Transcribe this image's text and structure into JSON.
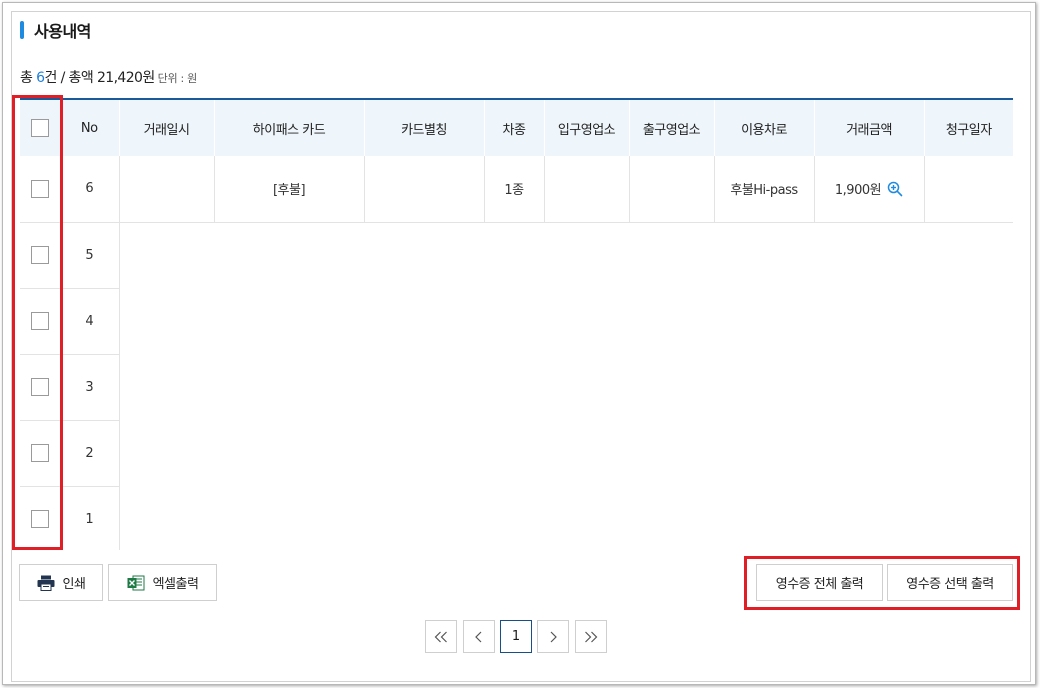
{
  "section": {
    "title": "사용내역"
  },
  "summary": {
    "prefix": "총 ",
    "count": "6",
    "count_suffix": "건 / 총액 21,420원",
    "unit": "단위 : 원"
  },
  "table": {
    "headers": [
      "No",
      "거래일시",
      "하이패스 카드",
      "카드별칭",
      "차종",
      "입구영업소",
      "출구영업소",
      "이용차로",
      "거래금액",
      "청구일자"
    ],
    "rows": [
      {
        "no": "6",
        "datetime": "",
        "card": "[후불]",
        "alias": "",
        "vehicle": "1종",
        "entry": "",
        "exit": "",
        "lane": "후불Hi-pass",
        "amount": "1,900원",
        "billing": ""
      },
      {
        "no": "5"
      },
      {
        "no": "4"
      },
      {
        "no": "3"
      },
      {
        "no": "2"
      },
      {
        "no": "1"
      }
    ]
  },
  "buttons": {
    "print": "인쇄",
    "excel": "엑셀출력",
    "receipt_all": "영수증 전체 출력",
    "receipt_selected": "영수증 선택 출력"
  },
  "pagination": {
    "first": "«",
    "prev": "‹",
    "current": "1",
    "next": "›",
    "last": "»"
  },
  "colors": {
    "accent": "#1f8be0",
    "header_bg": "#eef5fb",
    "header_border": "#1a5a9a",
    "highlight": "#e01e26",
    "excel_green": "#1d7a45",
    "print_navy": "#22344f"
  },
  "icons": [
    "print-icon",
    "excel-icon",
    "zoom-in-icon",
    "double-chevron-left-icon",
    "chevron-left-icon",
    "chevron-right-icon",
    "double-chevron-right-icon"
  ]
}
